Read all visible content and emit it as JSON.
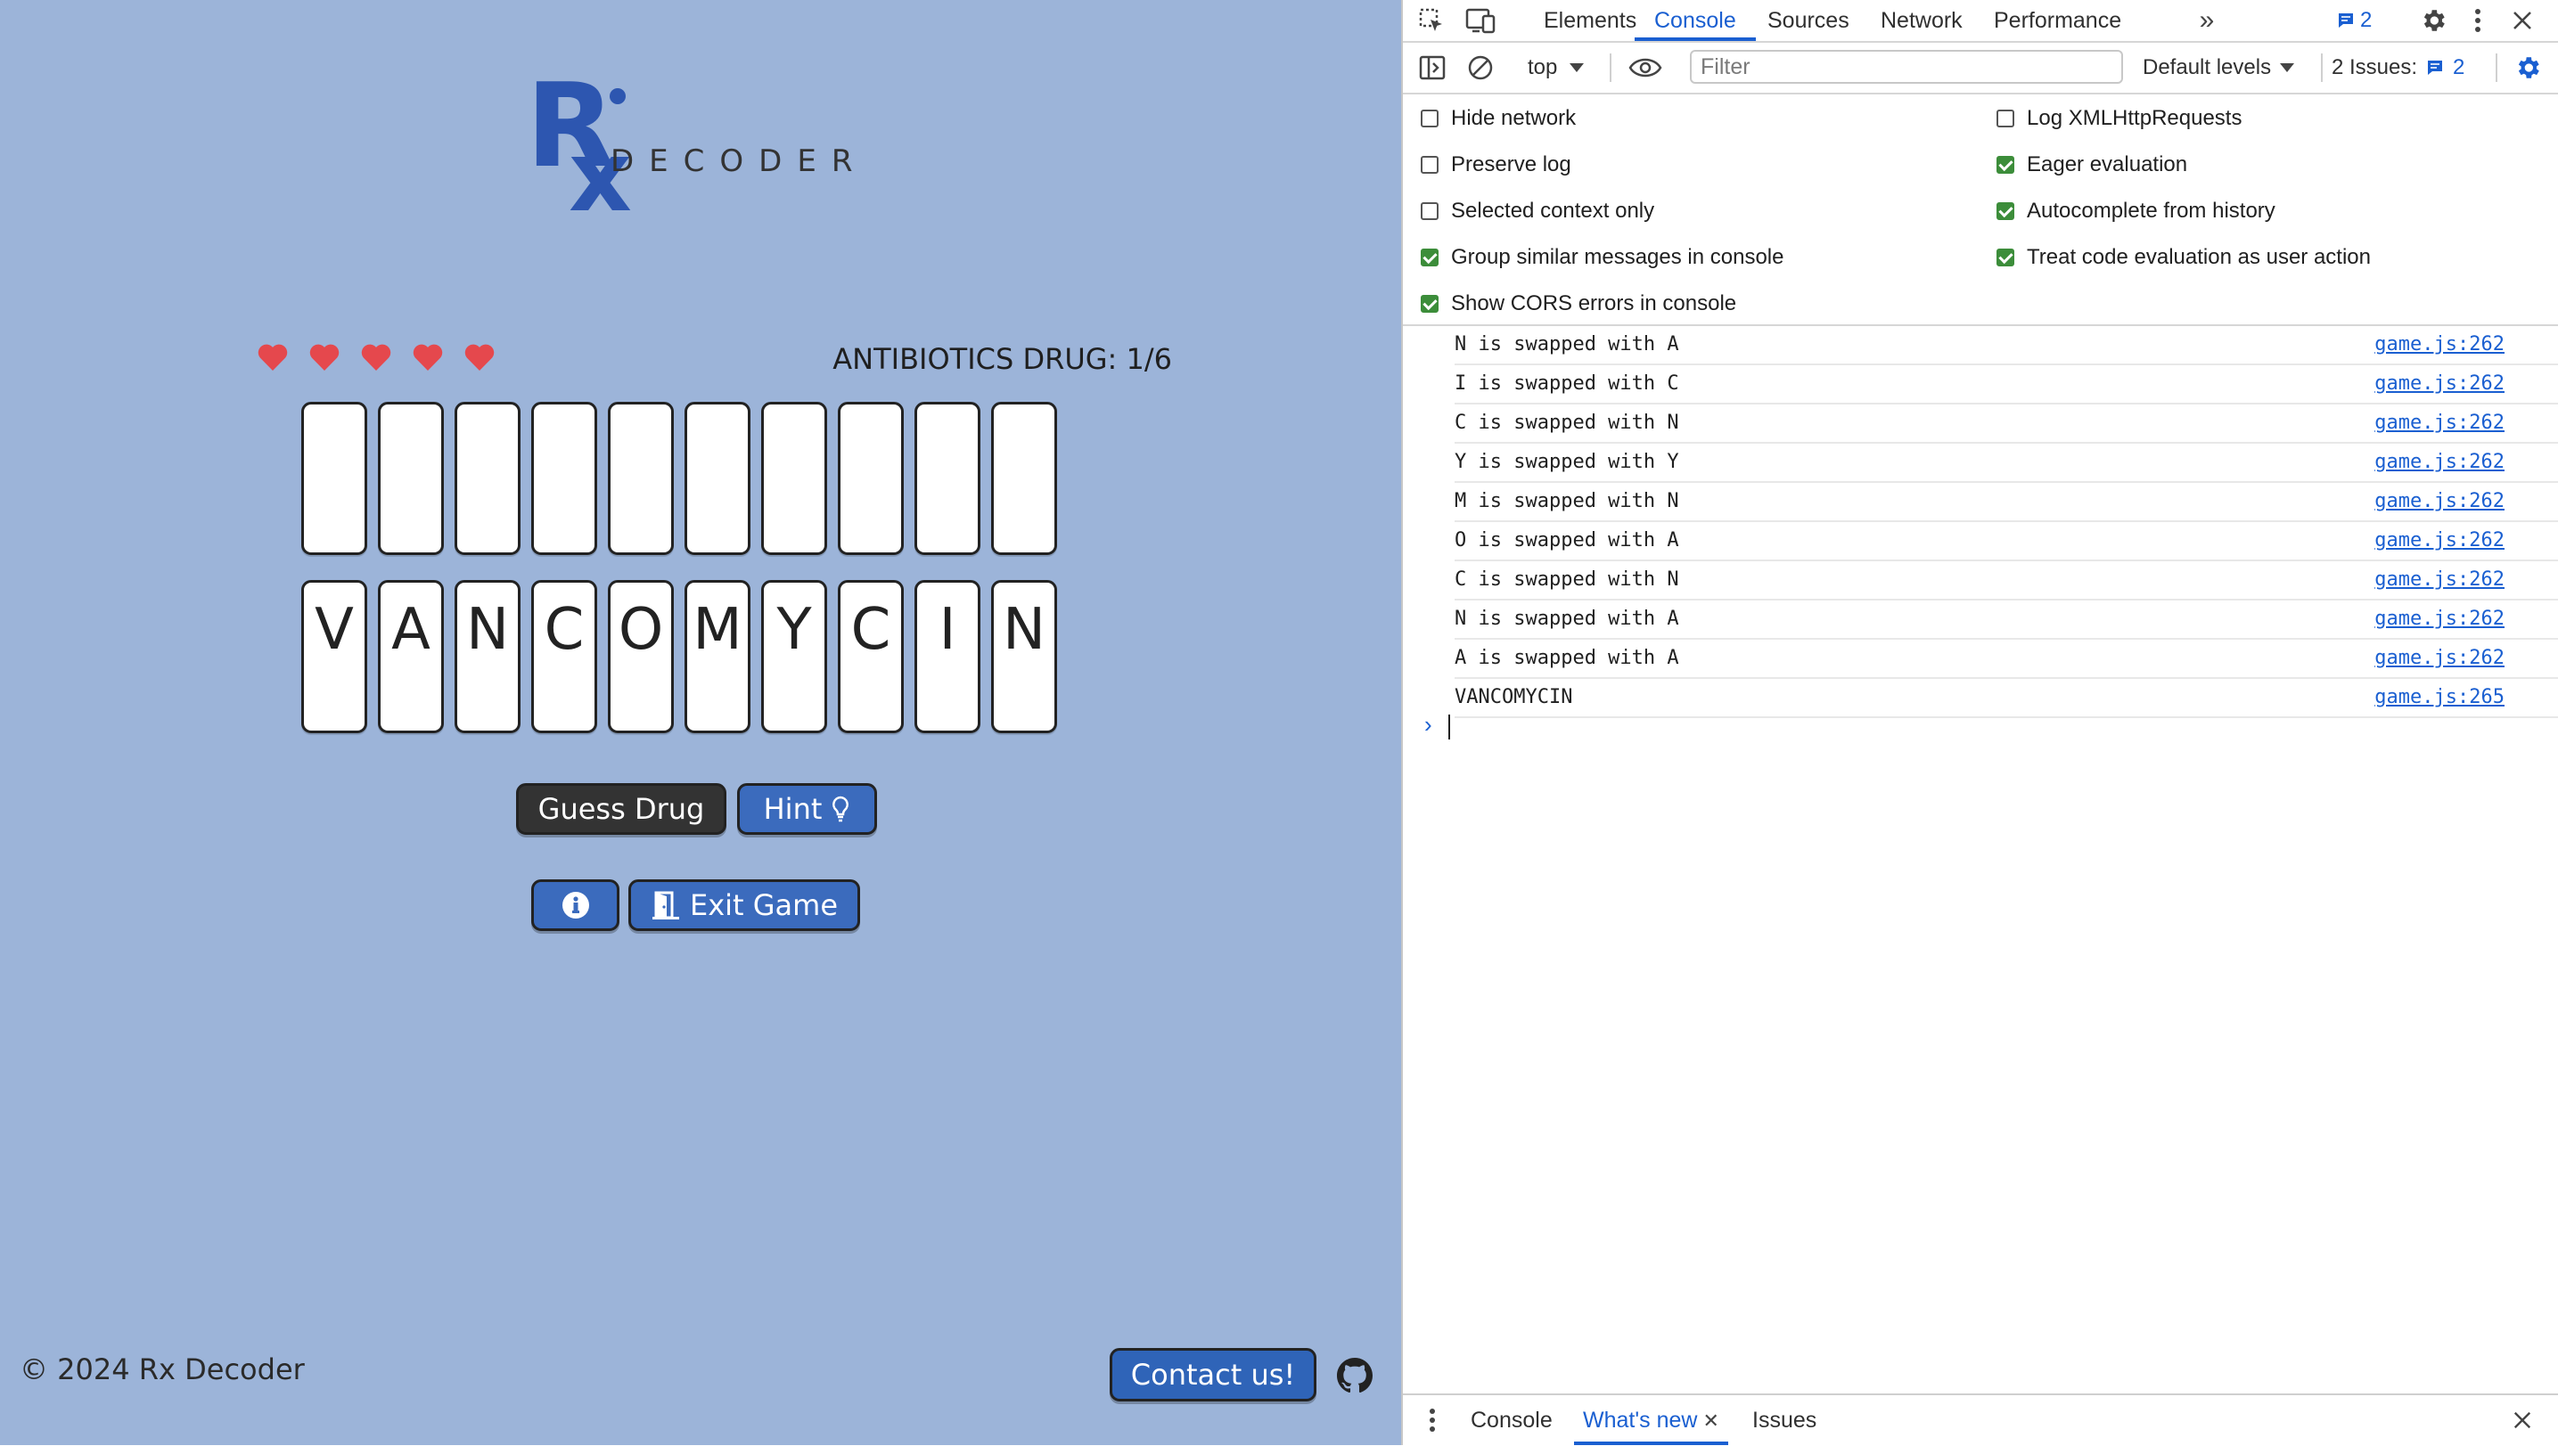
{
  "game": {
    "logo_text": "DECODER",
    "hearts": [
      "heart",
      "heart",
      "heart",
      "heart",
      "heart"
    ],
    "level_label": "ANTIBIOTICS DRUG: 1/6",
    "answer_tiles": [
      "",
      "",
      "",
      "",
      "",
      "",
      "",
      "",
      "",
      ""
    ],
    "letter_tiles": [
      "V",
      "A",
      "N",
      "C",
      "O",
      "M",
      "Y",
      "C",
      "I",
      "N"
    ],
    "guess_button": "Guess Drug",
    "hint_button": "Hint",
    "exit_button": "Exit Game",
    "copyright": "© 2024 Rx Decoder",
    "contact_button": "Contact us!",
    "colors": {
      "background": "#9cb4d9",
      "button_blue": "#3b6bbd",
      "button_dark": "#333333",
      "heart": "#e5484d",
      "logo_blue": "#2d56b0"
    }
  },
  "devtools": {
    "tabs": [
      "Elements",
      "Console",
      "Sources",
      "Network",
      "Performance"
    ],
    "active_tab": "Console",
    "more_tabs": "»",
    "message_count": "2",
    "context": "top",
    "filter_placeholder": "Filter",
    "levels": "Default levels",
    "issues_label": "2 Issues:",
    "issues_count": "2",
    "settings_left": [
      {
        "label": "Hide network",
        "checked": false
      },
      {
        "label": "Preserve log",
        "checked": false
      },
      {
        "label": "Selected context only",
        "checked": false
      },
      {
        "label": "Group similar messages in console",
        "checked": true
      },
      {
        "label": "Show CORS errors in console",
        "checked": true
      }
    ],
    "settings_right": [
      {
        "label": "Log XMLHttpRequests",
        "checked": false
      },
      {
        "label": "Eager evaluation",
        "checked": true
      },
      {
        "label": "Autocomplete from history",
        "checked": true
      },
      {
        "label": "Treat code evaluation as user action",
        "checked": true
      }
    ],
    "logs": [
      {
        "msg": "N is swapped with A",
        "src": "game.js:262"
      },
      {
        "msg": "I is swapped with C",
        "src": "game.js:262"
      },
      {
        "msg": "C is swapped with N",
        "src": "game.js:262"
      },
      {
        "msg": "Y is swapped with Y",
        "src": "game.js:262"
      },
      {
        "msg": "M is swapped with N",
        "src": "game.js:262"
      },
      {
        "msg": "O is swapped with A",
        "src": "game.js:262"
      },
      {
        "msg": "C is swapped with N",
        "src": "game.js:262"
      },
      {
        "msg": "N is swapped with A",
        "src": "game.js:262"
      },
      {
        "msg": "A is swapped with A",
        "src": "game.js:262"
      },
      {
        "msg": "VANCOMYCIN",
        "src": "game.js:265"
      }
    ],
    "drawer_tabs": [
      "Console",
      "What's new",
      "Issues"
    ],
    "drawer_active": "What's new"
  }
}
